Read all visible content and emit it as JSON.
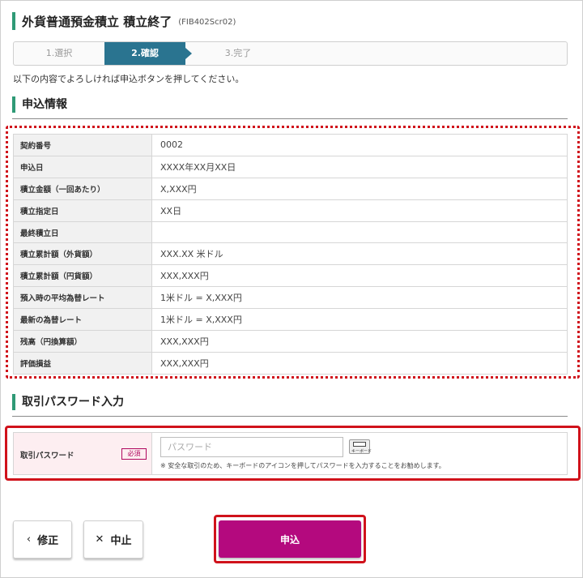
{
  "header": {
    "title": "外貨普通預金積立 積立終了",
    "screen_id": "(FIB402Scr02)"
  },
  "steps": [
    {
      "label": "1.選択",
      "active": false
    },
    {
      "label": "2.確認",
      "active": true
    },
    {
      "label": "3.完了",
      "active": false
    }
  ],
  "instruction": "以下の内容でよろしければ申込ボタンを押してください。",
  "application_info": {
    "heading": "申込情報",
    "rows": [
      {
        "label": "契約番号",
        "value": "0002"
      },
      {
        "label": "申込日",
        "value": "XXXX年XX月XX日"
      },
      {
        "label": "積立金額（一回あたり）",
        "value": "X,XXX円"
      },
      {
        "label": "積立指定日",
        "value": "XX日"
      },
      {
        "label": "最終積立日",
        "value": ""
      },
      {
        "label": "積立累計額（外貨額）",
        "value": "XXX.XX 米ドル"
      },
      {
        "label": "積立累計額（円貨額）",
        "value": "XXX,XXX円"
      },
      {
        "label": "預入時の平均為替レート",
        "value": "1米ドル = X,XXX円"
      },
      {
        "label": "最新の為替レート",
        "value": "1米ドル = X,XXX円"
      },
      {
        "label": "残高（円換算額）",
        "value": "XXX,XXX円"
      },
      {
        "label": "評価損益",
        "value": "XXX,XXX円"
      }
    ]
  },
  "password_section": {
    "heading": "取引パスワード入力",
    "label": "取引パスワード",
    "required_badge": "必須",
    "placeholder": "パスワード",
    "value": "",
    "keyboard_icon": "keyboard-icon",
    "keyboard_icon_text": "キーボード",
    "note": "※ 安全な取引のため、キーボードのアイコンを押してパスワードを入力することをお勧めします。"
  },
  "buttons": {
    "back_icon": "‹",
    "back_label": "修正",
    "cancel_icon": "✕",
    "cancel_label": "中止",
    "submit_label": "申込"
  },
  "colors": {
    "accent_green": "#2f9a76",
    "step_active": "#2a7490",
    "submit": "#b4097e",
    "highlight_red": "#d0121b"
  }
}
